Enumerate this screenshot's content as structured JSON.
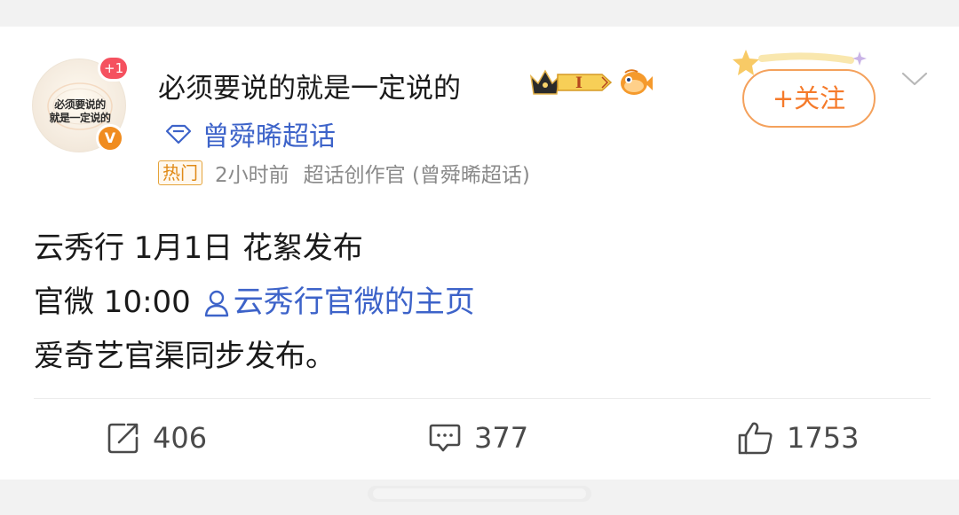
{
  "post": {
    "author": {
      "name": "必须要说的就是一定说的",
      "avatar_text_line1": "必须要说的",
      "avatar_text_line2": "就是一定说的",
      "notification_badge": "+1",
      "verified_badge": "V",
      "level_badge": "I"
    },
    "topic": "曾舜晞超话",
    "meta": {
      "tag": "热门",
      "time": "2小时前",
      "source": "超话创作官 (曾舜晞超话)"
    },
    "follow_label": "+关注",
    "content": {
      "line1": "云秀行 1月1日 花絮发布",
      "line2_prefix": "官微 10:00",
      "line2_mention": "云秀行官微的主页",
      "line3": "爱奇艺官渠同步发布。"
    },
    "actions": {
      "repost_count": "406",
      "comment_count": "377",
      "like_count": "1753"
    }
  },
  "colors": {
    "link_blue": "#3d63c9",
    "follow_orange": "#f57a2a",
    "hot_tag_orange": "#e08a17",
    "badge_red": "#f5515f",
    "verified_orange": "#f08c1f",
    "meta_gray": "#8a8a8a"
  },
  "icons": {
    "topic": "diamond-icon",
    "mention": "person-icon",
    "menu": "chevron-down-icon",
    "repost": "repost-icon",
    "comment": "comment-icon",
    "like": "thumbs-up-icon",
    "member_badge": "crown-icon",
    "fan_badge": "fish-icon"
  }
}
